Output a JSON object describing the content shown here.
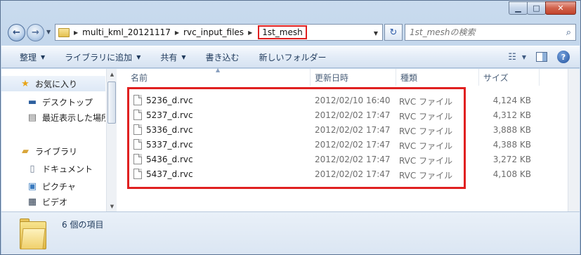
{
  "window": {
    "caption_buttons": {
      "minimize": "▁",
      "maximize": "□",
      "close": "✕"
    }
  },
  "address": {
    "segments": [
      "multi_kml_20121117",
      "rvc_input_files",
      "1st_mesh"
    ],
    "current": "1st_mesh"
  },
  "search": {
    "placeholder": "1st_meshの検索"
  },
  "toolbar": {
    "organize": "整理",
    "add_to_library": "ライブラリに追加",
    "share": "共有",
    "burn": "書き込む",
    "new_folder": "新しいフォルダー"
  },
  "sidebar": {
    "favorites": "お気に入り",
    "desktop": "デスクトップ",
    "recent": "最近表示した場所",
    "libraries": "ライブラリ",
    "documents": "ドキュメント",
    "pictures": "ピクチャ",
    "videos": "ビデオ"
  },
  "columns": {
    "name": "名前",
    "modified": "更新日時",
    "type": "種類",
    "size": "サイズ"
  },
  "files": [
    {
      "name": "5236_d.rvc",
      "modified": "2012/02/10 16:40",
      "type": "RVC ファイル",
      "size": "4,124 KB"
    },
    {
      "name": "5237_d.rvc",
      "modified": "2012/02/02 17:47",
      "type": "RVC ファイル",
      "size": "4,312 KB"
    },
    {
      "name": "5336_d.rvc",
      "modified": "2012/02/02 17:47",
      "type": "RVC ファイル",
      "size": "3,888 KB"
    },
    {
      "name": "5337_d.rvc",
      "modified": "2012/02/02 17:47",
      "type": "RVC ファイル",
      "size": "4,388 KB"
    },
    {
      "name": "5436_d.rvc",
      "modified": "2012/02/02 17:47",
      "type": "RVC ファイル",
      "size": "3,272 KB"
    },
    {
      "name": "5437_d.rvc",
      "modified": "2012/02/02 17:47",
      "type": "RVC ファイル",
      "size": "4,108 KB"
    }
  ],
  "status": {
    "item_count": "6 個の項目"
  },
  "colors": {
    "highlight": "#e02020",
    "toolbar_text": "#1e395b"
  }
}
